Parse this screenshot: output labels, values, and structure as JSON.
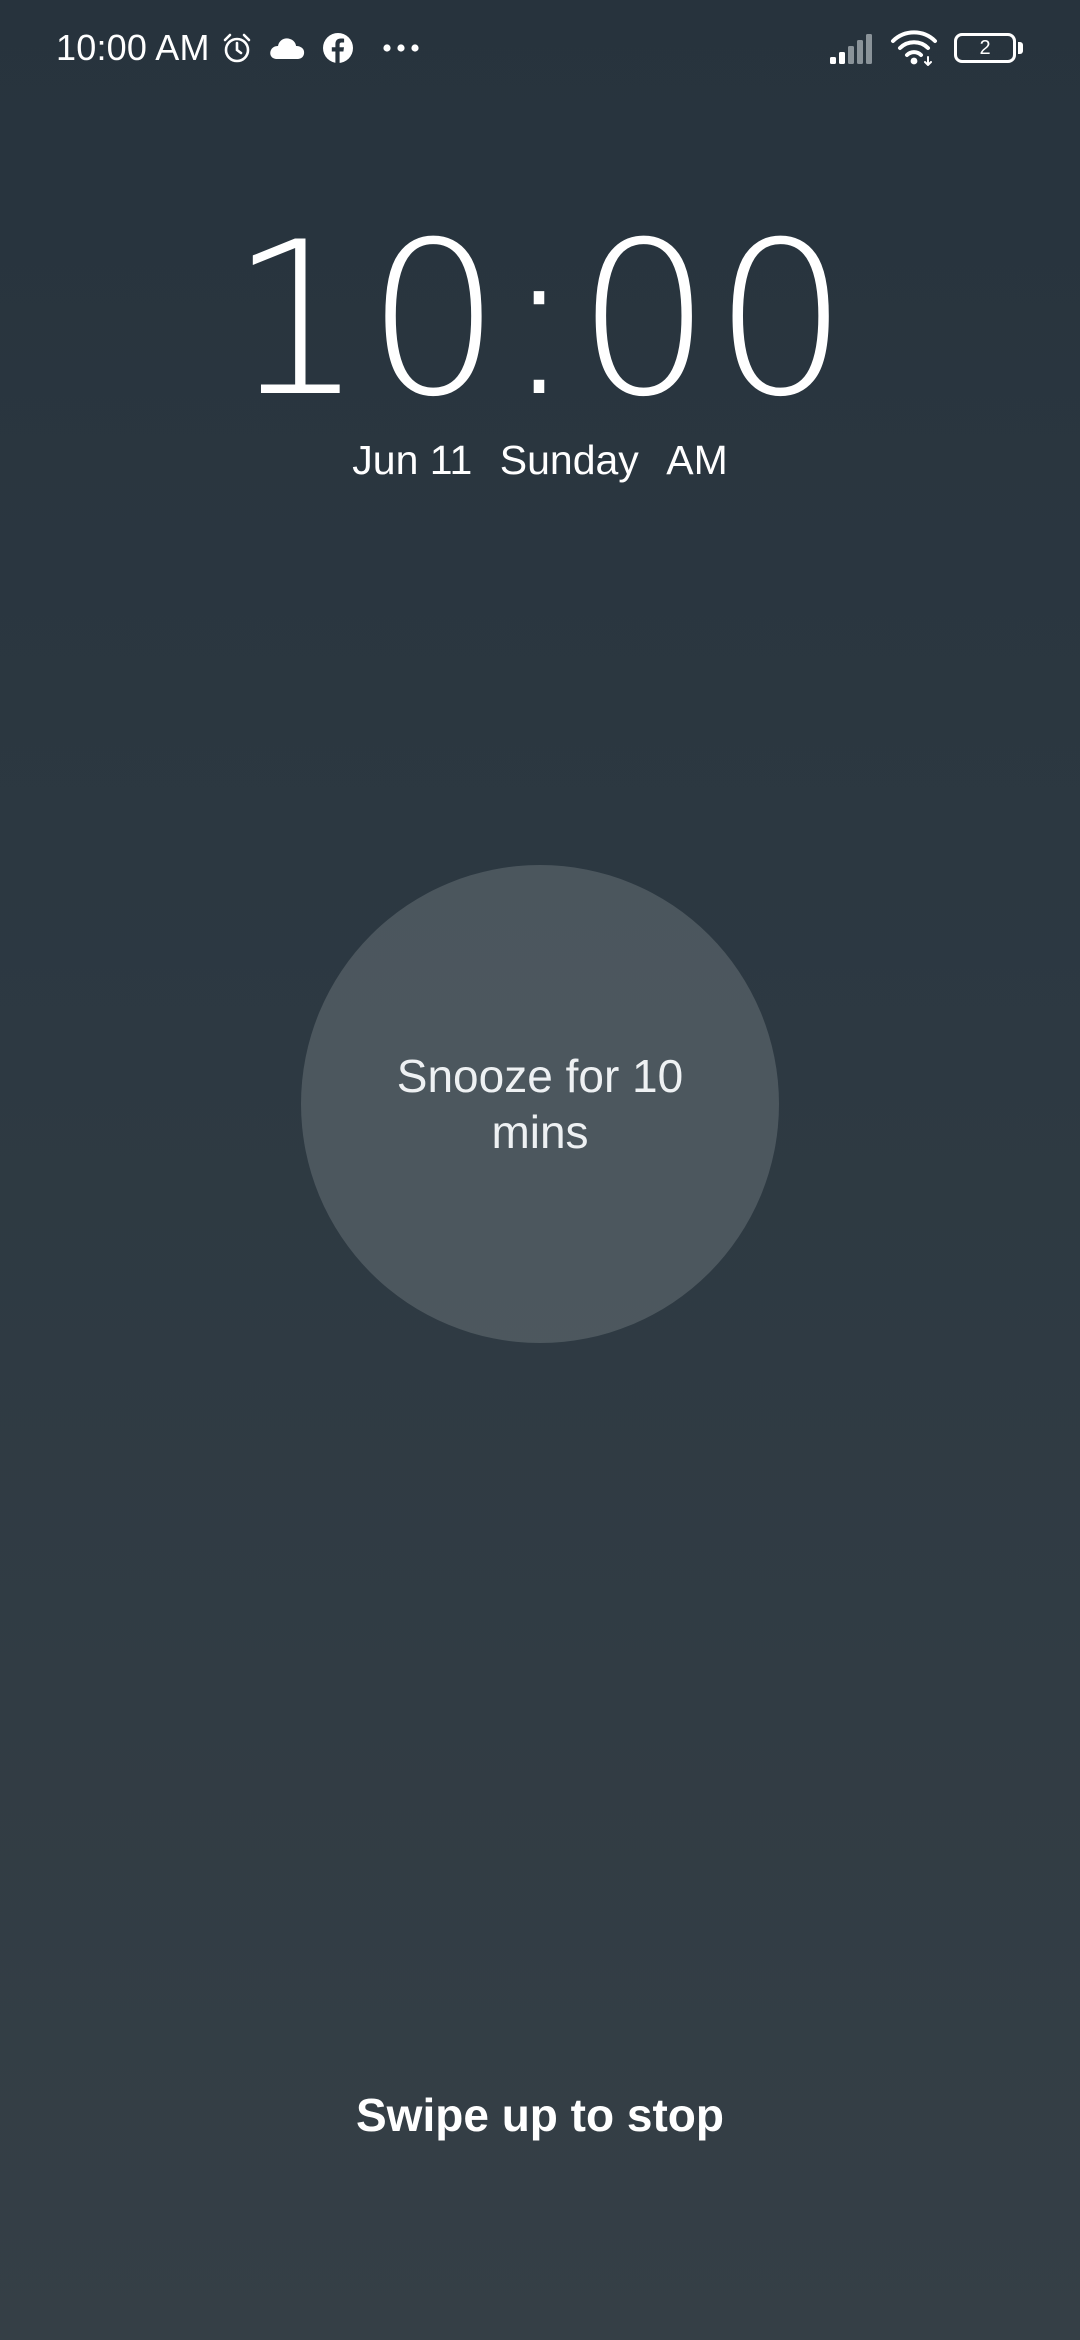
{
  "status_bar": {
    "time": "10:00 AM",
    "notification_icons": [
      "alarm-icon",
      "cloud-icon",
      "facebook-icon",
      "more-dots-icon"
    ],
    "system_icons": [
      "signal-icon",
      "wifi-icon",
      "battery-icon"
    ],
    "battery_level": "2"
  },
  "clock": {
    "time": "10:00",
    "date": "Jun 11",
    "weekday": "Sunday",
    "period": "AM"
  },
  "snooze": {
    "label": "Snooze for 10 mins"
  },
  "swipe_hint": "Swipe up to stop",
  "colors": {
    "background_top": "#27333d",
    "background_bottom": "#353f46",
    "snooze_circle": "#4a545b",
    "text": "#ffffff"
  }
}
